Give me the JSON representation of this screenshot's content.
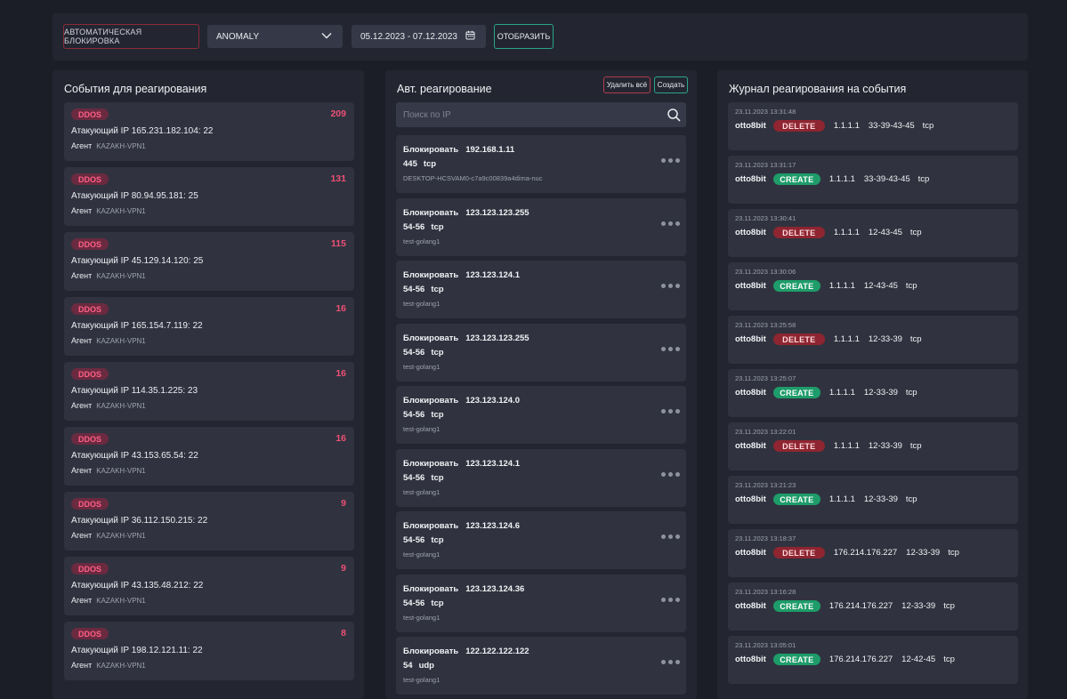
{
  "toolbar": {
    "auto_block_label": "АВТОМАТИЧЕСКАЯ БЛОКИРОВКА",
    "mode_value": "ANOMALY",
    "date_range": "05.12.2023 - 07.12.2023",
    "show_label": "ОТОБРАЗИТЬ"
  },
  "events_panel": {
    "title": "События для реагирования",
    "ip_label": "Атакующий IP",
    "agent_label": "Агент",
    "items": [
      {
        "type": "DDOS",
        "count": "209",
        "ip": "165.231.182.104: 22",
        "agent": "KAZAKH-VPN1"
      },
      {
        "type": "DDOS",
        "count": "131",
        "ip": "80.94.95.181: 25",
        "agent": "KAZAKH-VPN1"
      },
      {
        "type": "DDOS",
        "count": "115",
        "ip": "45.129.14.120: 25",
        "agent": "KAZAKH-VPN1"
      },
      {
        "type": "DDOS",
        "count": "16",
        "ip": "165.154.7.119: 22",
        "agent": "KAZAKH-VPN1"
      },
      {
        "type": "DDOS",
        "count": "16",
        "ip": "114.35.1.225: 23",
        "agent": "KAZAKH-VPN1"
      },
      {
        "type": "DDOS",
        "count": "16",
        "ip": "43.153.65.54: 22",
        "agent": "KAZAKH-VPN1"
      },
      {
        "type": "DDOS",
        "count": "9",
        "ip": "36.112.150.215: 22",
        "agent": "KAZAKH-VPN1"
      },
      {
        "type": "DDOS",
        "count": "9",
        "ip": "43.135.48.212: 22",
        "agent": "KAZAKH-VPN1"
      },
      {
        "type": "DDOS",
        "count": "8",
        "ip": "198.12.121.11: 22",
        "agent": "KAZAKH-VPN1"
      }
    ]
  },
  "auto_panel": {
    "title": "Авт. реагирование",
    "delete_all_label": "Удалить всё",
    "create_label": "Создать",
    "search_placeholder": "Поиск по IP",
    "action_label": "Блокировать",
    "rules": [
      {
        "ip": "192.168.1.11",
        "ports": "445",
        "proto": "tcp",
        "host": "DESKTOP-HCSVAM0-c7a9c00839a4dima-nuc"
      },
      {
        "ip": "123.123.123.255",
        "ports": "54-56",
        "proto": "tcp",
        "host": "test-golang1"
      },
      {
        "ip": "123.123.124.1",
        "ports": "54-56",
        "proto": "tcp",
        "host": "test-golang1"
      },
      {
        "ip": "123.123.123.255",
        "ports": "54-56",
        "proto": "tcp",
        "host": "test-golang1"
      },
      {
        "ip": "123.123.124.0",
        "ports": "54-56",
        "proto": "tcp",
        "host": "test-golang1"
      },
      {
        "ip": "123.123.124.1",
        "ports": "54-56",
        "proto": "tcp",
        "host": "test-golang1"
      },
      {
        "ip": "123.123.124.6",
        "ports": "54-56",
        "proto": "tcp",
        "host": "test-golang1"
      },
      {
        "ip": "123.123.124.36",
        "ports": "54-56",
        "proto": "tcp",
        "host": "test-golang1"
      },
      {
        "ip": "122.122.122.122",
        "ports": "54",
        "proto": "udp",
        "host": "test-golang1"
      }
    ]
  },
  "log_panel": {
    "title": "Журнал реагирования на события",
    "entries": [
      {
        "time": "23.11.2023 13:31:48",
        "user": "otto8bit",
        "action": "DELETE",
        "ip": "1.1.1.1",
        "ports": "33-39-43-45",
        "proto": "tcp"
      },
      {
        "time": "23.11.2023 13:31:17",
        "user": "otto8bit",
        "action": "CREATE",
        "ip": "1.1.1.1",
        "ports": "33-39-43-45",
        "proto": "tcp"
      },
      {
        "time": "23.11.2023 13:30:41",
        "user": "otto8bit",
        "action": "DELETE",
        "ip": "1.1.1.1",
        "ports": "12-43-45",
        "proto": "tcp"
      },
      {
        "time": "23.11.2023 13:30:06",
        "user": "otto8bit",
        "action": "CREATE",
        "ip": "1.1.1.1",
        "ports": "12-43-45",
        "proto": "tcp"
      },
      {
        "time": "23.11.2023 13:25:58",
        "user": "otto8bit",
        "action": "DELETE",
        "ip": "1.1.1.1",
        "ports": "12-33-39",
        "proto": "tcp"
      },
      {
        "time": "23.11.2023 13:25:07",
        "user": "otto8bit",
        "action": "CREATE",
        "ip": "1.1.1.1",
        "ports": "12-33-39",
        "proto": "tcp"
      },
      {
        "time": "23.11.2023 13:22:01",
        "user": "otto8bit",
        "action": "DELETE",
        "ip": "1.1.1.1",
        "ports": "12-33-39",
        "proto": "tcp"
      },
      {
        "time": "23.11.2023 13:21:23",
        "user": "otto8bit",
        "action": "CREATE",
        "ip": "1.1.1.1",
        "ports": "12-33-39",
        "proto": "tcp"
      },
      {
        "time": "23.11.2023 13:18:37",
        "user": "otto8bit",
        "action": "DELETE",
        "ip": "176.214.176.227",
        "ports": "12-33-39",
        "proto": "tcp"
      },
      {
        "time": "23.11.2023 13:16:28",
        "user": "otto8bit",
        "action": "CREATE",
        "ip": "176.214.176.227",
        "ports": "12-33-39",
        "proto": "tcp"
      },
      {
        "time": "23.11.2023 13:05:01",
        "user": "otto8bit",
        "action": "CREATE",
        "ip": "176.214.176.227",
        "ports": "12-42-45",
        "proto": "tcp"
      }
    ]
  },
  "colors": {
    "background": "#1b1e27",
    "panel": "#232631",
    "card": "#30333f",
    "danger": "#ef4f74",
    "delete_badge": "#8e2530",
    "create_badge": "#1e9c6a",
    "accent_border": "#2aa58a"
  },
  "icons": {
    "mode_select": "chevron-down-icon",
    "date_picker": "calendar-icon",
    "search": "search-icon",
    "rule_menu": "more-dots-icon"
  }
}
